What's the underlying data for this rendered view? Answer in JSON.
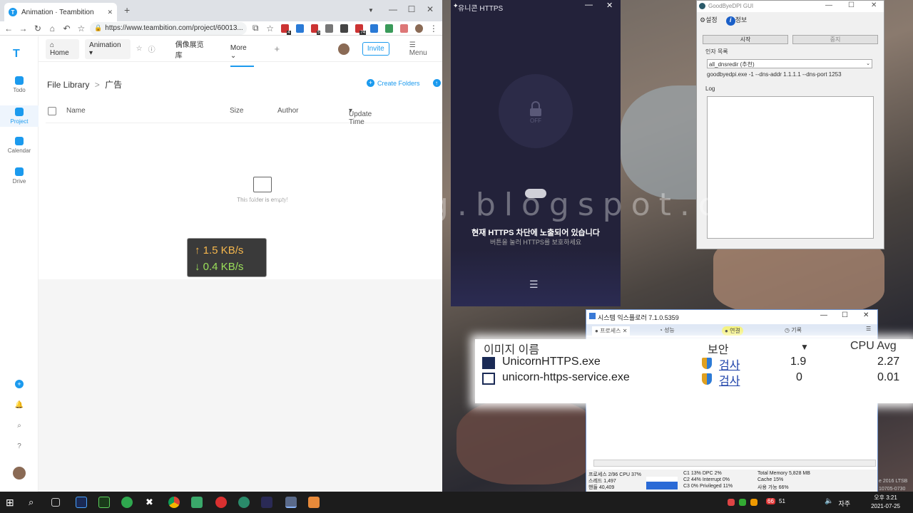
{
  "chrome": {
    "tab_title": "Animation · Teambition",
    "tab_close": "✕",
    "new_tab": "+",
    "min": "—",
    "max": "☐",
    "close": "✕",
    "url": "https://www.teambition.com/project/60013...",
    "ext_badges": [
      "4",
      "5",
      "74"
    ]
  },
  "teambition": {
    "nav": [
      {
        "label": "Todo"
      },
      {
        "label": "Project"
      },
      {
        "label": "Calendar"
      },
      {
        "label": "Drive"
      }
    ],
    "header": {
      "home": "Home",
      "project": "Animation",
      "tab1": "偶像展览库",
      "tab2": "More",
      "invite": "Invite",
      "menu": "Menu"
    },
    "breadcrumb_root": "File Library",
    "breadcrumb_sep": ">",
    "breadcrumb_current": "广告",
    "create_folders": "Create Folders",
    "columns": [
      "Name",
      "Size",
      "Author",
      "Update Time"
    ],
    "empty_text": "This folder is empty!"
  },
  "netspeed": {
    "up": "↑ 1.5 KB/s",
    "down": "↓ 0.4 KB/s"
  },
  "unicorn": {
    "title": "유니콘 HTTPS",
    "status_label": "OFF",
    "message": "현재 HTTPS 차단에 노출되어 있습니다",
    "sub_message": "버튼을 눌러 HTTPS를 보호하세요"
  },
  "watermark": "singingdalong.blogspot.com",
  "gdpi": {
    "title": "GoodByeDPI GUI",
    "menu_settings": "설정",
    "menu_info": "정보",
    "start": "시작",
    "stop": "중지",
    "arg_label": "인자 목록",
    "arg_selected": "all_dnsredir (추천)",
    "command": "goodbyedpi.exe -1 --dns-addr 1.1.1.1 --dns-port 1253",
    "log_label": "Log"
  },
  "sysexplorer": {
    "title": "시스템 익스플로러 7.1.0.5359",
    "tabs": [
      "프로세스",
      "성능",
      "연결",
      "기록"
    ],
    "stats": [
      "프로세스 2/96  CPU 37%",
      "스레드 1,497",
      "핸들 40,409",
      "C1 13%  DPC 2%",
      "C2 44%  Interrupt 0%",
      "C3 0%  Privileged 11%",
      "Total Memory 5,828 MB",
      "Cache 15%",
      "사용 가능 66%"
    ]
  },
  "zoom": {
    "col_image": "이미지 이름",
    "col_security": "보안",
    "col_cpu": "CPU Avg",
    "rows": [
      {
        "name": "UnicornHTTPS.exe",
        "check": "검사",
        "cpu": "1.9",
        "avg": "2.27"
      },
      {
        "name": "unicorn-https-service.exe",
        "check": "검사",
        "cpu": "0",
        "avg": "0.01"
      }
    ]
  },
  "taskbar": {
    "ime": "자주",
    "time": "오후 3:21",
    "date": "2021-07-25",
    "badge1": "66",
    "badge2": "51"
  },
  "desktop_text": [
    "e 2016 LTSB",
    "10705-0730"
  ]
}
